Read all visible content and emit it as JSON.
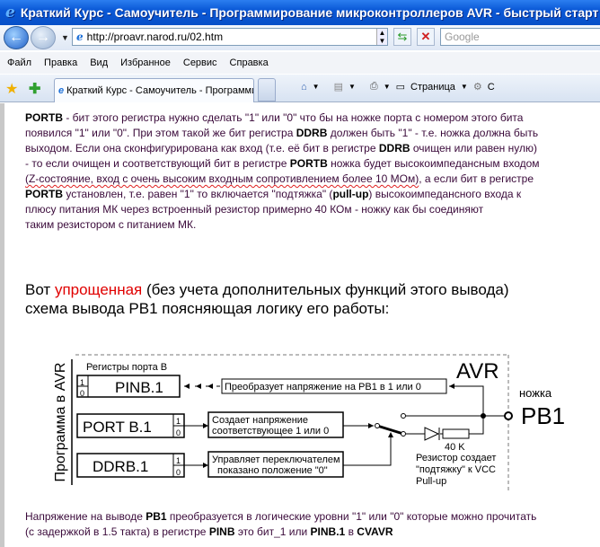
{
  "window": {
    "title": "Краткий Курс - Самоучитель - Программирование микроконтроллеров AVR - быстрый старт с нул..."
  },
  "nav": {
    "url": "http://proavr.narod.ru/02.htm",
    "search_placeholder": "Google"
  },
  "menu": [
    "Файл",
    "Правка",
    "Вид",
    "Избранное",
    "Сервис",
    "Справка"
  ],
  "tab": {
    "label": "Краткий Курс - Самоучитель - Программирование ..."
  },
  "toolbar": {
    "page_label": "Страница",
    "service_label": "С"
  },
  "p1": {
    "l0": [
      "PORTB",
      " - бит этого регистра нужно сделать \"1\" или \"0\" что бы на ножке порта с номером этого бита"
    ],
    "l1": [
      "появился  \"1\" или \"0\". При этом такой же бит регистра ",
      "DDRB",
      "  должен быть \"1\" - т.е. ножка должна быть"
    ],
    "l2": [
      "выходом.  Если она сконфигурирована как вход (т.е. её бит в регистре ",
      "DDRB",
      "  очищен или равен нулю)"
    ],
    "l3": [
      "- то если очищен и соответствующий бит в регистре ",
      "PORTB",
      " ножка будет высокоимпедансным входом"
    ],
    "l4": [
      "(Z-состояние, вход с очень высоким входным сопротивлением более 10 МОм)",
      ", а если бит в регистре"
    ],
    "l5": [
      "PORTB",
      " установлен, т.е. равен \"1\" то включается \"подтяжка\" (",
      "pull-up",
      ") высокоимпедансного входа к"
    ],
    "l6": "плюсу питания МК через встроенный резистор примерно 40 КОм - ножку как бы соединяют",
    "l7": "таким резистором с питанием МК."
  },
  "p2": {
    "a": "Вот ",
    "b": "упрощенная",
    "c": " (без учета дополнительных функций этого вывода)",
    "d": "схема вывода  PB1 поясняющая логику его работы:"
  },
  "diagram": {
    "side_label": "Программа в AVR",
    "registers_label": "Регистры порта В",
    "avr": "AVR",
    "pin_caption": "ножка",
    "pin": "PB1",
    "pinb": "PINB.1",
    "portb": "PORT B.1",
    "ddrb": "DDRB.1",
    "bit1": "1",
    "bit0": "0",
    "convert": "Преобразует напряжение  на PB1  в 1 или 0",
    "create1": "Создает напряжение",
    "create2": "соответствующее 1 или 0",
    "control1": "Управляет переключателем",
    "control2": "показано положение \"0\"",
    "resistor": "40 K",
    "note1": "Резистор создает",
    "note2": "\"подтяжку\" к VCC",
    "note3": "Pull-up"
  },
  "p3": {
    "l0": [
      "Напряжение на выводе ",
      "PB1",
      "  преобразуется в логические уровни \"1\" или \"0\" которые можно прочитать"
    ],
    "l1": [
      "(с задержкой в 1.5 такта) в регистре ",
      "PINB",
      "  это бит_1 или  ",
      "PINB.1",
      "  в ",
      "CVAVR"
    ]
  }
}
